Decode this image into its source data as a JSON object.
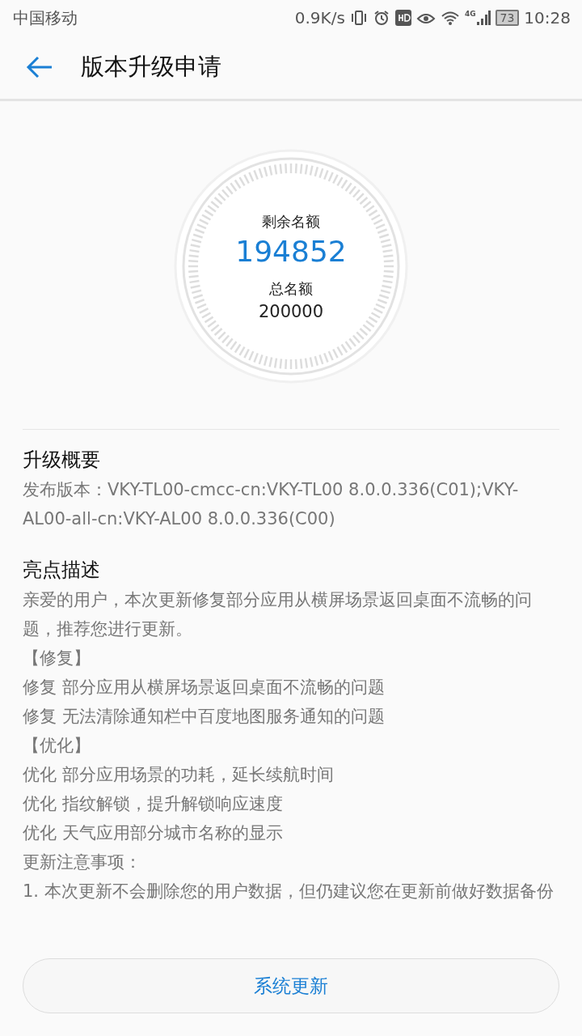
{
  "status_bar": {
    "carrier": "中国移动",
    "speed": "0.9K/s",
    "network": "4G",
    "battery": "73",
    "time": "10:28"
  },
  "toolbar": {
    "title": "版本升级申请"
  },
  "quota": {
    "remaining_label": "剩余名额",
    "remaining": "194852",
    "total_label": "总名额",
    "total": "200000"
  },
  "sections": [
    {
      "title": "升级概要",
      "lines": [
        "发布版本：VKY-TL00-cmcc-cn:VKY-TL00 8.0.0.336(C01);VKY-AL00-all-cn:VKY-AL00 8.0.0.336(C00)"
      ]
    },
    {
      "title": "亮点描述",
      "lines": [
        "亲爱的用户，本次更新修复部分应用从横屏场景返回桌面不流畅的问题，推荐您进行更新。",
        "【修复】",
        "修复 部分应用从横屏场景返回桌面不流畅的问题",
        "修复 无法清除通知栏中百度地图服务通知的问题",
        "【优化】",
        "优化 部分应用场景的功耗，延长续航时间",
        "优化 指纹解锁，提升解锁响应速度",
        "优化 天气应用部分城市名称的显示",
        "更新注意事项：",
        "1. 本次更新不会删除您的用户数据，但仍建议您在更新前做好数据备份"
      ]
    }
  ],
  "button": {
    "label": "系统更新"
  }
}
